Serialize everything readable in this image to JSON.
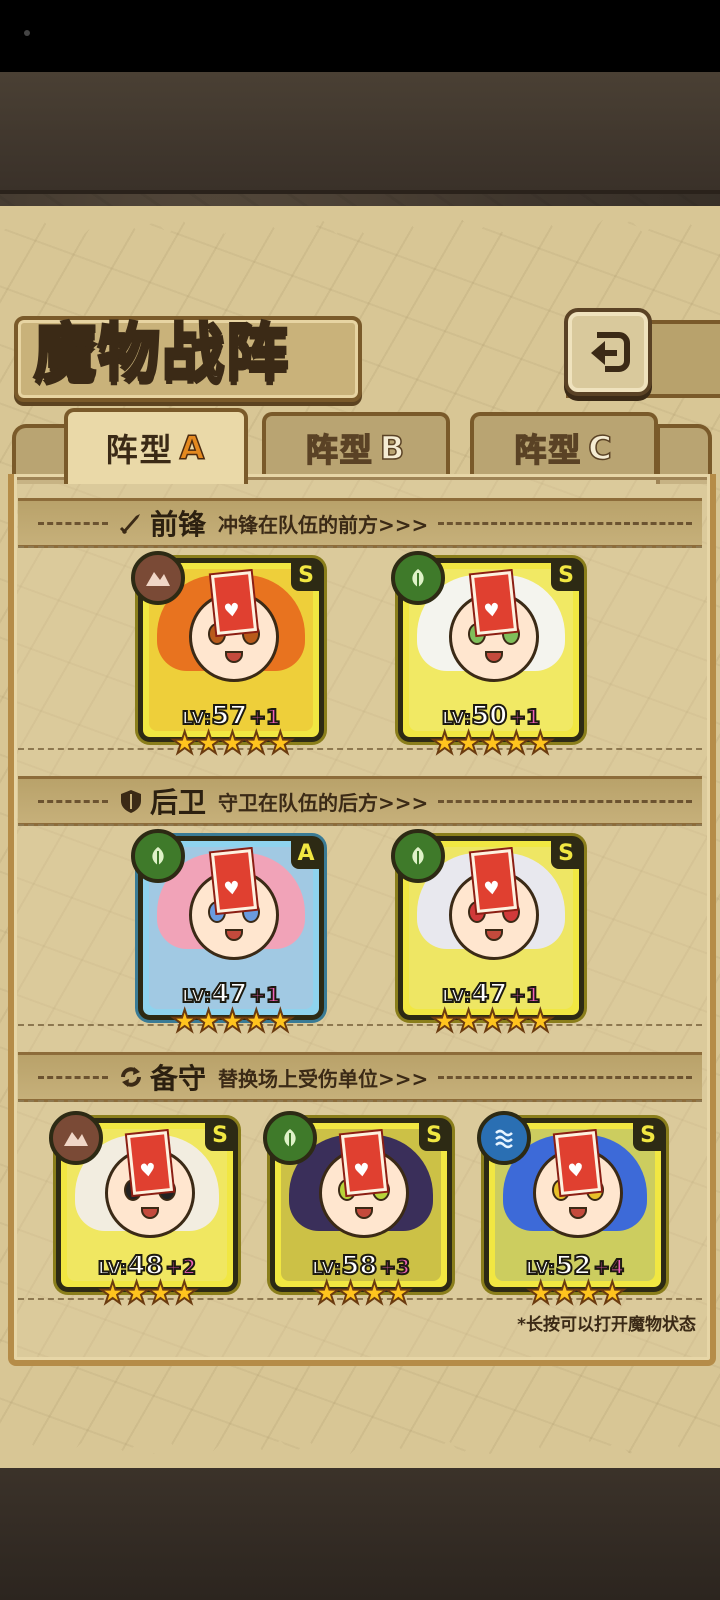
{
  "page": {
    "title": "魔物战阵",
    "back_label": "",
    "hint": "*长按可以打开魔物状态"
  },
  "tabs": [
    {
      "label": "阵型",
      "letter": "A",
      "active": true
    },
    {
      "label": "阵型",
      "letter": "B",
      "active": false
    },
    {
      "label": "阵型",
      "letter": "C",
      "active": false
    }
  ],
  "sections": {
    "front": {
      "title": "前锋",
      "desc": "冲锋在队伍的前方>>>",
      "icon": "sword-icon"
    },
    "rear": {
      "title": "后卫",
      "desc": "守卫在队伍的后方>>>",
      "icon": "shield-icon"
    },
    "reserve": {
      "title": "备守",
      "desc": "替换场上受伤单位>>>",
      "icon": "swap-icon"
    }
  },
  "cards": {
    "front_1": {
      "lv": "57",
      "plus": "+1",
      "grade": "S",
      "element": "rock",
      "stars": "★★★★★",
      "colors": {
        "hair": "#e8731f",
        "eye": "#b85a1a"
      }
    },
    "front_2": {
      "lv": "50",
      "plus": "+1",
      "grade": "S",
      "element": "leaf",
      "stars": "★★★★★",
      "colors": {
        "hair": "#f4f4ee",
        "eye": "#7fbf5a"
      }
    },
    "rear_1": {
      "lv": "47",
      "plus": "+1",
      "grade": "A",
      "element": "leaf",
      "stars": "★★★★★",
      "colors": {
        "hair": "#f1a3b8",
        "eye": "#6a9be0"
      }
    },
    "rear_2": {
      "lv": "47",
      "plus": "+1",
      "grade": "S",
      "element": "leaf",
      "stars": "★★★★★",
      "colors": {
        "hair": "#e8e8ee",
        "eye": "#d03a3a"
      }
    },
    "reserve_1": {
      "lv": "48",
      "plus": "+2",
      "grade": "S",
      "element": "rock",
      "stars": "★★★★",
      "colors": {
        "hair": "#f2ede0",
        "eye": "#222222"
      }
    },
    "reserve_2": {
      "lv": "58",
      "plus": "+3",
      "grade": "S",
      "element": "leaf",
      "stars": "★★★★",
      "colors": {
        "hair": "#3a2f5a",
        "eye": "#b8d43a"
      }
    },
    "reserve_3": {
      "lv": "52",
      "plus": "+4",
      "grade": "S",
      "element": "water",
      "stars": "★★★★",
      "colors": {
        "hair": "#3d6ad8",
        "eye": "#e8c02a"
      }
    }
  },
  "level_prefix": "LV:"
}
